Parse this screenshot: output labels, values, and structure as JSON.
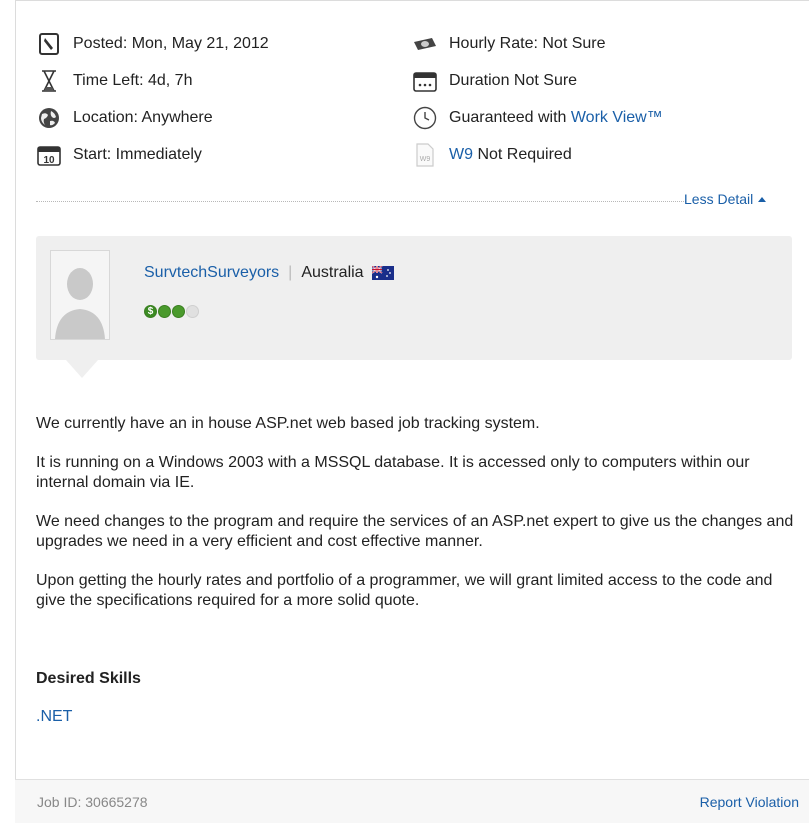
{
  "meta": {
    "posted": "Posted: Mon, May 21, 2012",
    "time_left": "Time Left: 4d, 7h",
    "location": "Location: Anywhere",
    "start": "Start: Immediately",
    "hourly_rate": "Hourly Rate: Not Sure",
    "duration": "Duration Not Sure",
    "guaranteed_prefix": "Guaranteed with",
    "guaranteed_link": "Work View™",
    "w9_link": "W9",
    "w9_suffix": "Not Required",
    "calendar_day": "10",
    "w9_icon_text": "W9"
  },
  "toggle": {
    "less_detail": "Less Detail"
  },
  "client": {
    "name": "SurvtechSurveyors",
    "country": "Australia",
    "rating_dollar": "$",
    "rating_filled": 3,
    "rating_total": 4
  },
  "description": {
    "paragraphs": [
      "We currently have an in house ASP.net web based job tracking system.",
      "It is running on a Windows 2003 with a MSSQL database. It is accessed only to computers within our internal domain via IE.",
      "We need changes to the program and require the services of an ASP.net expert to give us the changes and upgrades we need in a very efficient and cost effective manner.",
      "Upon getting the hourly rates and portfolio of a programmer, we will grant limited access to the code and give the specifications required for a more solid quote."
    ]
  },
  "skills": {
    "heading": "Desired Skills",
    "items": [
      ".NET"
    ]
  },
  "footer": {
    "job_id": "Job ID: 30665278",
    "report": "Report Violation"
  },
  "colors": {
    "link": "#1a5fa8",
    "panel": "#efefef",
    "rating_green": "#4a9a2c"
  }
}
